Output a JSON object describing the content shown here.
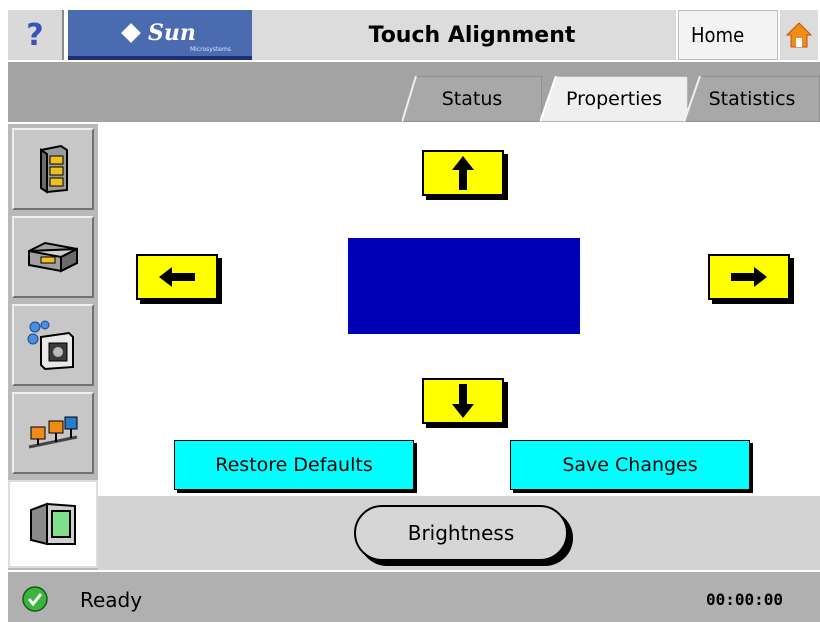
{
  "header": {
    "help_label": "?",
    "logo_text": "Sun",
    "logo_subtext": "Microsystems",
    "title": "Touch Alignment",
    "home_label": "Home"
  },
  "tabs": [
    {
      "label": "Status",
      "active": false
    },
    {
      "label": "Properties",
      "active": true
    },
    {
      "label": "Statistics",
      "active": false
    }
  ],
  "sidebar": {
    "items": [
      {
        "icon": "server-rack-icon",
        "active": false
      },
      {
        "icon": "tape-drive-icon",
        "active": false
      },
      {
        "icon": "device-bubbles-icon",
        "active": false
      },
      {
        "icon": "network-nodes-icon",
        "active": false
      },
      {
        "icon": "monitor-display-icon",
        "active": true
      }
    ]
  },
  "alignment": {
    "up_icon": "arrow-up-icon",
    "down_icon": "arrow-down-icon",
    "left_icon": "arrow-left-icon",
    "right_icon": "arrow-right-icon",
    "target_color": "#0000b4",
    "arrow_color": "#ffff00"
  },
  "actions": {
    "restore_label": "Restore Defaults",
    "save_label": "Save Changes",
    "brightness_label": "Brightness",
    "button_color": "#00ffff"
  },
  "status": {
    "text": "Ready",
    "clock": "00:00:00",
    "icon": "check-ok-icon"
  }
}
